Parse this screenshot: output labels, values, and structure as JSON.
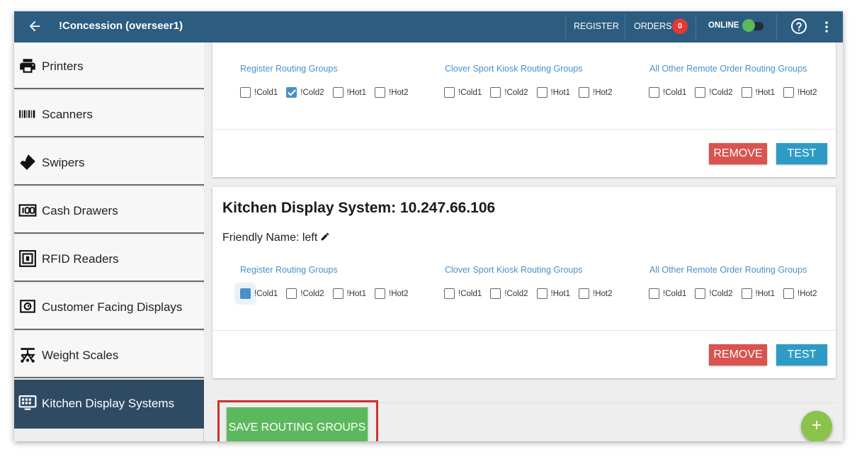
{
  "header": {
    "title": "!Concession (overseer1)",
    "nav_register": "REGISTER",
    "nav_orders": "ORDERS",
    "orders_count": "0",
    "nav_online": "ONLINE",
    "online_toggle_on": true
  },
  "sidebar": {
    "items": [
      {
        "label": "Printers",
        "icon": "printer-icon"
      },
      {
        "label": "Scanners",
        "icon": "barcode-icon"
      },
      {
        "label": "Swipers",
        "icon": "card-swiper-icon"
      },
      {
        "label": "Cash Drawers",
        "icon": "cash-drawer-icon"
      },
      {
        "label": "RFID Readers",
        "icon": "rfid-icon"
      },
      {
        "label": "Customer Facing Displays",
        "icon": "customer-display-icon"
      },
      {
        "label": "Weight Scales",
        "icon": "scale-icon"
      },
      {
        "label": "Kitchen Display Systems",
        "icon": "monitor-icon",
        "active": true
      }
    ]
  },
  "routing_headers": {
    "register": "Register Routing Groups",
    "kiosk": "Clover Sport Kiosk Routing Groups",
    "remote": "All Other Remote Order Routing Groups"
  },
  "routing_options": [
    "!Cold1",
    "!Cold2",
    "!Hot1",
    "!Hot2"
  ],
  "devices": [
    {
      "register_checked": [
        false,
        true,
        false,
        false
      ],
      "kiosk_checked": [
        false,
        false,
        false,
        false
      ],
      "remote_checked": [
        false,
        false,
        false,
        false
      ],
      "remove_label": "REMOVE",
      "test_label": "TEST"
    },
    {
      "title": "Kitchen Display System: 10.247.66.106",
      "friendly_name": "Friendly Name: left",
      "register_checked": [
        false,
        false,
        false,
        false
      ],
      "register_focused_index": 0,
      "kiosk_checked": [
        false,
        false,
        false,
        false
      ],
      "remote_checked": [
        false,
        false,
        false,
        false
      ],
      "remove_label": "REMOVE",
      "test_label": "TEST"
    }
  ],
  "footer": {
    "save_label": "SAVE ROUTING GROUPS",
    "add_label": "+"
  },
  "colors": {
    "topbar": "#2c5d80",
    "sidebar_active": "#2f4a63",
    "remove": "#d9534f",
    "test": "#2e9bc6",
    "save": "#5cb85c",
    "fab": "#8bc34a",
    "group_header": "#4a90c8",
    "highlight_box": "#d0322b"
  }
}
